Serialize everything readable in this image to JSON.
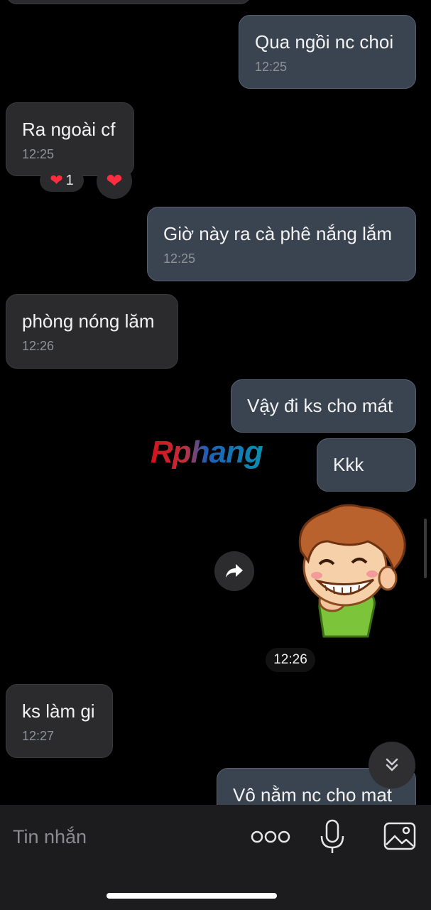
{
  "messages": [
    {
      "id": "m1",
      "direction": "out",
      "text": "Qua ngồi nc choi",
      "time": "12:25"
    },
    {
      "id": "m2",
      "direction": "in",
      "text": "Ra ngoài cf",
      "time": "12:25",
      "reaction": {
        "emoji": "❤️",
        "count": "1"
      }
    },
    {
      "id": "m3",
      "direction": "out",
      "text": "Giờ này ra cà phê nắng lắm",
      "time": "12:25"
    },
    {
      "id": "m4",
      "direction": "in",
      "text": "phòng nóng lăm",
      "time": "12:26"
    },
    {
      "id": "m5",
      "direction": "out",
      "text": "Vậy đi ks cho mát"
    },
    {
      "id": "m6",
      "direction": "out",
      "text": "Kkk"
    },
    {
      "id": "m7",
      "direction": "out",
      "type": "sticker",
      "time": "12:26"
    },
    {
      "id": "m8",
      "direction": "in",
      "text": "ks làm gi",
      "time": "12:27"
    },
    {
      "id": "m9",
      "direction": "out",
      "text": "Vô nằm nc cho mat"
    }
  ],
  "watermark": "Rphang",
  "composer": {
    "placeholder": "Tin nhắn"
  },
  "icons": {
    "forward": "share-forward-icon",
    "scroll": "chevron-double-down-icon",
    "more": "more-dots-icon",
    "mic": "microphone-icon",
    "image": "image-icon",
    "heart": "heart-icon"
  },
  "colors": {
    "background": "#000000",
    "incoming": "#2b2b2d",
    "outgoing": "#3a4350",
    "heart": "#ff2d3f"
  }
}
